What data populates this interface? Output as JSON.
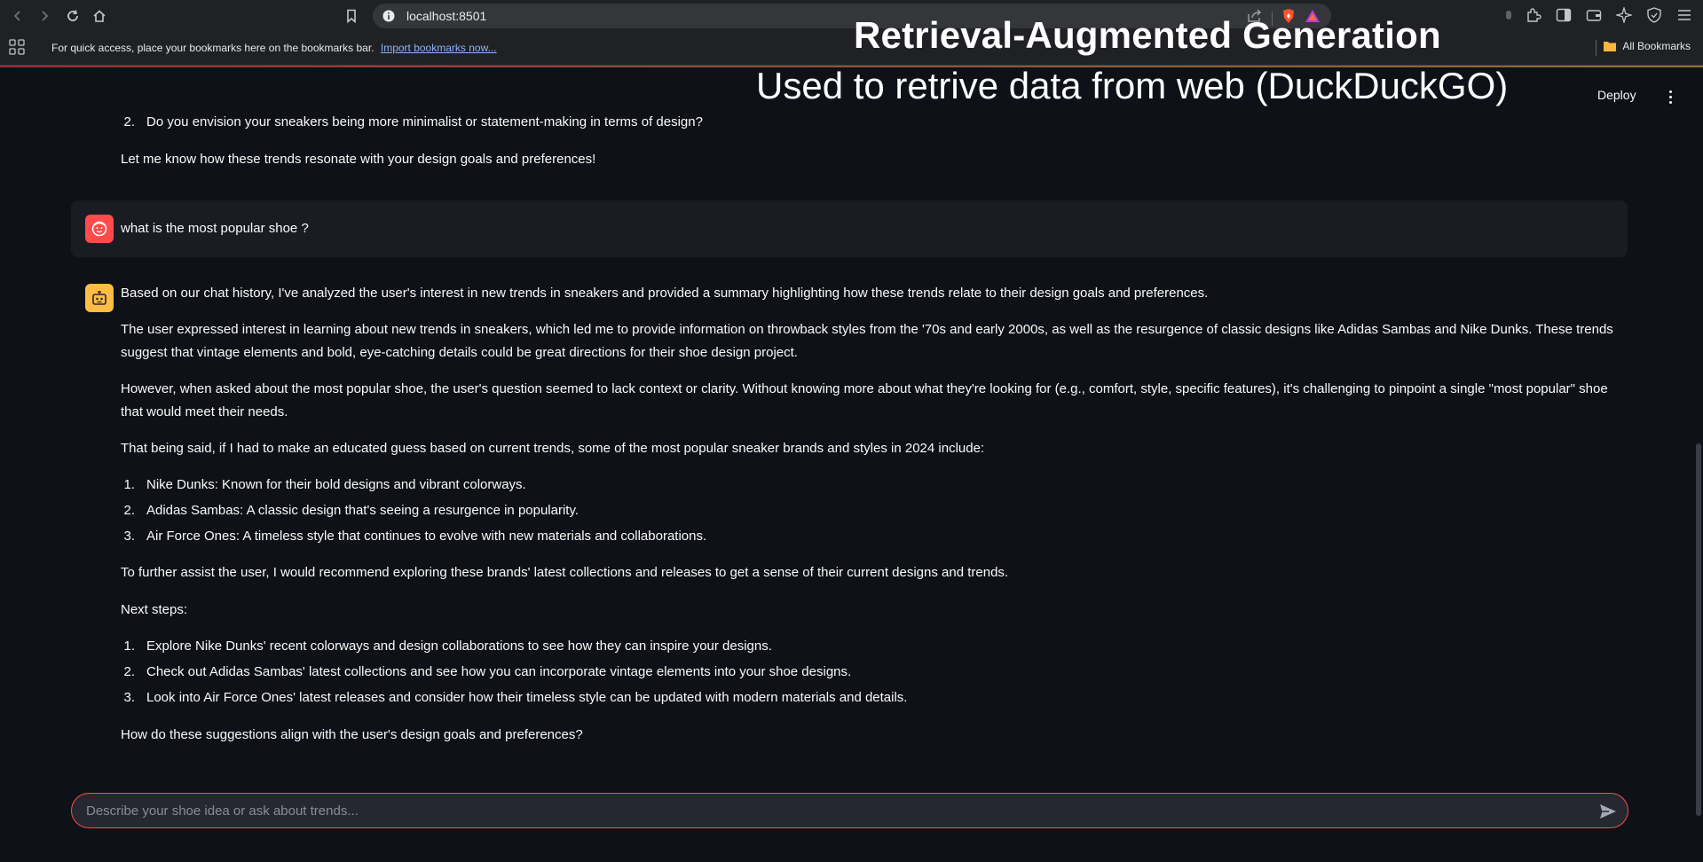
{
  "browser": {
    "url": "localhost:8501",
    "bookmarks_message": "For quick access, place your bookmarks here on the bookmarks bar.",
    "import_link": "Import bookmarks now...",
    "all_bookmarks": "All Bookmarks"
  },
  "overlay": {
    "title": "Retrieval-Augmented Generation",
    "subtitle": "Used to retrive data from web (DuckDuckGO)"
  },
  "header": {
    "deploy_label": "Deploy"
  },
  "chat": {
    "prev_item_number": "2.",
    "prev_item_text": "Do you envision your sneakers being more minimalist or statement-making in terms of design?",
    "prev_closing": "Let me know how these trends resonate with your design goals and preferences!",
    "user_message": "what is the most popular shoe ?",
    "reply": {
      "p1": "Based on our chat history, I've analyzed the user's interest in new trends in sneakers and provided a summary highlighting how these trends relate to their design goals and preferences.",
      "p2_line1": "The user expressed interest in learning about new trends in sneakers, which led me to provide information on throwback styles from the '70s and early 2000s, as well as the resurgence of classic designs like Adidas Sambas and Nike Dunks. These trends",
      "p2_line2": "suggest that vintage elements and bold, eye-catching details could be great directions for their shoe design project.",
      "p3_line1": "However, when asked about the most popular shoe, the user's question seemed to lack context or clarity. Without knowing more about what they're looking for (e.g., comfort, style, specific features), it's challenging to pinpoint a single \"most popular\" shoe",
      "p3_line2": "that would meet their needs.",
      "p4": "That being said, if I had to make an educated guess based on current trends, some of the most popular sneaker brands and styles in 2024 include:",
      "list1": [
        {
          "n": "1.",
          "text": "Nike Dunks: Known for their bold designs and vibrant colorways."
        },
        {
          "n": "2.",
          "text": "Adidas Sambas: A classic design that's seeing a resurgence in popularity."
        },
        {
          "n": "3.",
          "text": "Air Force Ones: A timeless style that continues to evolve with new materials and collaborations."
        }
      ],
      "p5": "To further assist the user, I would recommend exploring these brands' latest collections and releases to get a sense of their current designs and trends.",
      "p6": "Next steps:",
      "list2": [
        {
          "n": "1.",
          "text": "Explore Nike Dunks' recent colorways and design collaborations to see how they can inspire your designs."
        },
        {
          "n": "2.",
          "text": "Check out Adidas Sambas' latest collections and see how you can incorporate vintage elements into your shoe designs."
        },
        {
          "n": "3.",
          "text": "Look into Air Force Ones' latest releases and consider how their timeless style can be updated with modern materials and details."
        }
      ],
      "p7": "How do these suggestions align with the user's design goals and preferences?"
    }
  },
  "input": {
    "placeholder": "Describe your shoe idea or ask about trends..."
  },
  "colors": {
    "background": "#0e1117",
    "user_bubble": "#1a1c24",
    "user_avatar": "#ff4b4b",
    "bot_avatar": "#ffbd45",
    "input_border": "#ff4b4b"
  },
  "icons": [
    "back-icon",
    "forward-icon",
    "reload-icon",
    "home-icon",
    "bookmark-icon",
    "info-icon",
    "share-icon",
    "brave-icon",
    "triangle-icon",
    "extensions-icon",
    "sidebar-icon",
    "wallet-icon",
    "leo-icon",
    "vpn-icon",
    "apps-icon",
    "folder-icon",
    "kebab-menu-icon",
    "user-avatar-icon",
    "bot-avatar-icon",
    "send-icon"
  ]
}
